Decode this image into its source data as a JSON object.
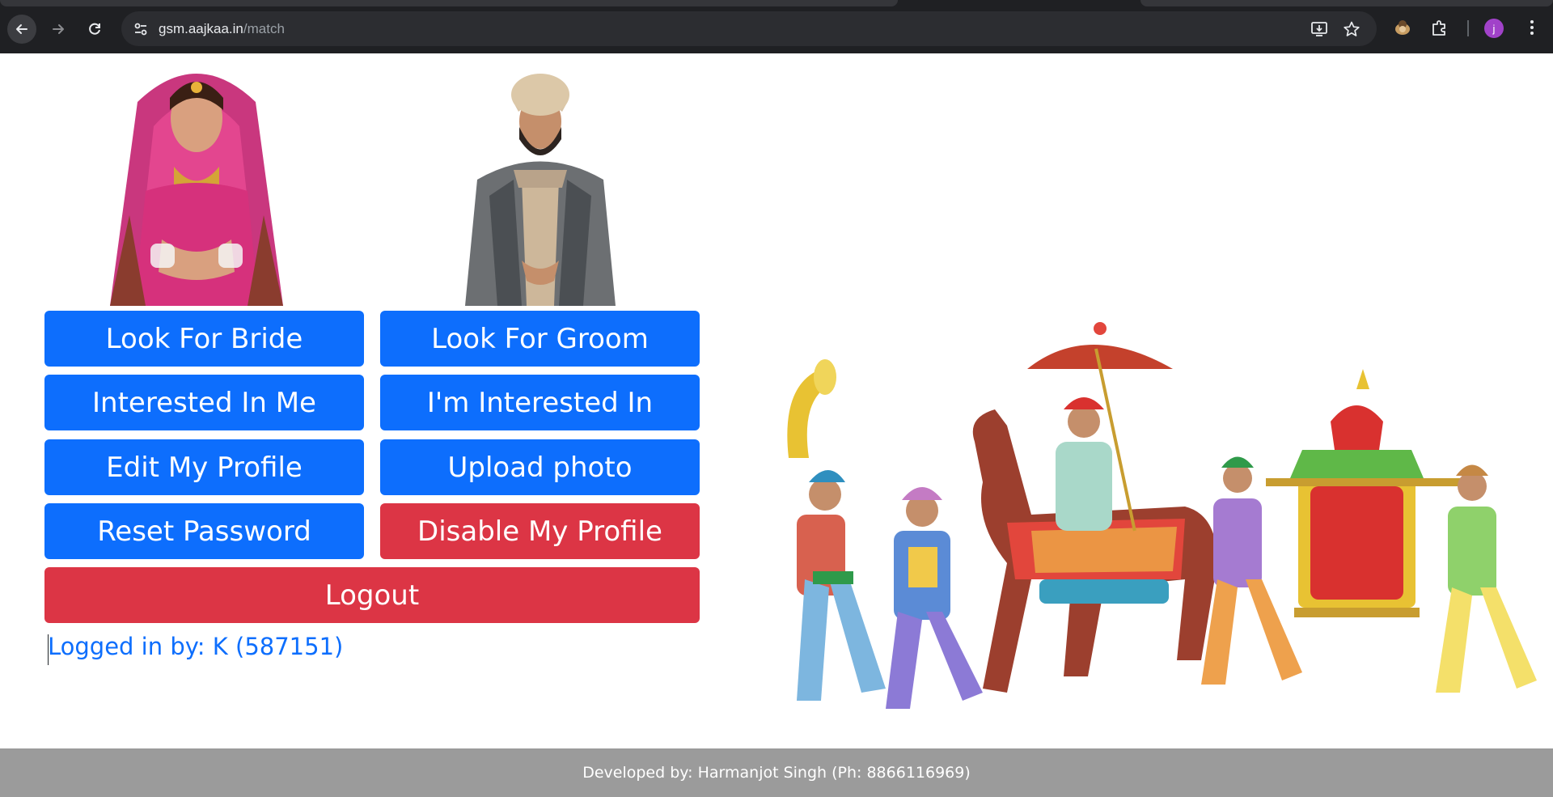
{
  "browser": {
    "url_host": "gsm.aajkaa.in",
    "url_path": "/match",
    "profile_initial": "j"
  },
  "icons": {
    "back": "arrow-left-icon",
    "forward": "arrow-right-icon",
    "reload": "reload-icon",
    "site_settings": "tune-icon",
    "install": "install-app-icon",
    "bookmark": "star-icon",
    "extension_avatar": "extension-icon",
    "extensions": "puzzle-icon",
    "menu": "kebab-menu-icon"
  },
  "colors": {
    "primary": "#0d6efd",
    "danger": "#dc3545",
    "footer_bg": "#9b9b9b"
  },
  "menu": {
    "look_for_bride": "Look For Bride",
    "look_for_groom": "Look For Groom",
    "interested_in_me": "Interested In Me",
    "im_interested_in": "I'm Interested In",
    "edit_my_profile": "Edit My Profile",
    "upload_photo": "Upload photo",
    "reset_password": "Reset Password",
    "disable_my_profile": "Disable My Profile",
    "logout": "Logout"
  },
  "status": {
    "logged_in_by": "Logged in by: K (587151)"
  },
  "footer": {
    "credit": "Developed by: Harmanjot Singh (Ph: 8866116969)"
  }
}
